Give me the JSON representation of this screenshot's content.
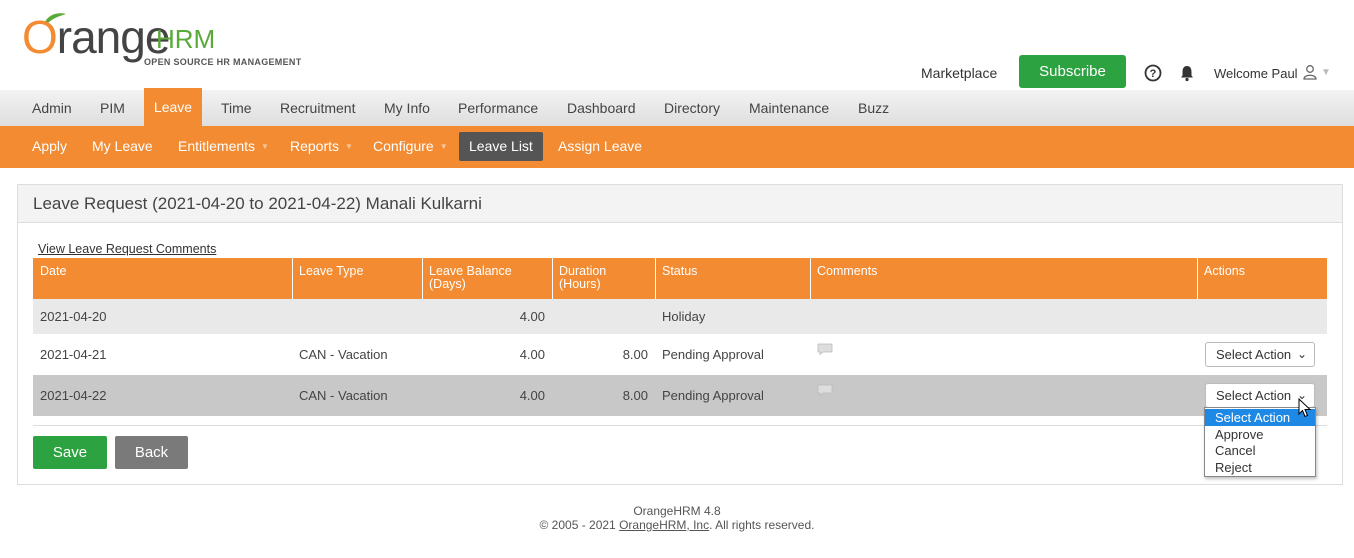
{
  "brand": {
    "logo_main": "range",
    "logo_o": "O",
    "logo_hrm": "HRM",
    "logo_tagline": "OPEN SOURCE HR MANAGEMENT",
    "orange": "#f28b31",
    "green": "#2da241"
  },
  "header": {
    "marketplace": "Marketplace",
    "subscribe": "Subscribe",
    "welcome": "Welcome Paul",
    "icons": [
      "help-icon",
      "bell-icon",
      "user-icon"
    ]
  },
  "main_nav": [
    "Admin",
    "PIM",
    "Leave",
    "Time",
    "Recruitment",
    "My Info",
    "Performance",
    "Dashboard",
    "Directory",
    "Maintenance",
    "Buzz"
  ],
  "main_nav_active": "Leave",
  "sub_nav": [
    "Apply",
    "My Leave",
    "Entitlements",
    "Reports",
    "Configure",
    "Leave List",
    "Assign Leave"
  ],
  "sub_nav_active": "Leave List",
  "panel": {
    "title": "Leave Request (2021-04-20 to 2021-04-22) Manali Kulkarni",
    "view_comments": "View Leave Request Comments"
  },
  "table": {
    "headers": {
      "date": "Date",
      "leave_type": "Leave Type",
      "balance_1": "Leave Balance",
      "balance_2": "(Days)",
      "duration_1": "Duration",
      "duration_2": "(Hours)",
      "status": "Status",
      "comments": "Comments",
      "actions": "Actions"
    },
    "rows": [
      {
        "date": "2021-04-20",
        "type": "",
        "balance": "4.00",
        "duration": "",
        "status": "Holiday"
      },
      {
        "date": "2021-04-21",
        "type": "CAN - Vacation",
        "balance": "4.00",
        "duration": "8.00",
        "status": "Pending Approval",
        "action": "Select Action"
      },
      {
        "date": "2021-04-22",
        "type": "CAN - Vacation",
        "balance": "4.00",
        "duration": "8.00",
        "status": "Pending Approval",
        "action": "Select Action"
      }
    ]
  },
  "buttons": {
    "save": "Save",
    "back": "Back"
  },
  "dropdown_options": [
    "Select Action",
    "Approve",
    "Cancel",
    "Reject"
  ],
  "footer": {
    "version": "OrangeHRM 4.8",
    "copyright_prefix": "© 2005 - 2021",
    "company": "OrangeHRM, Inc",
    "copyright_suffix": ". All rights reserved."
  }
}
